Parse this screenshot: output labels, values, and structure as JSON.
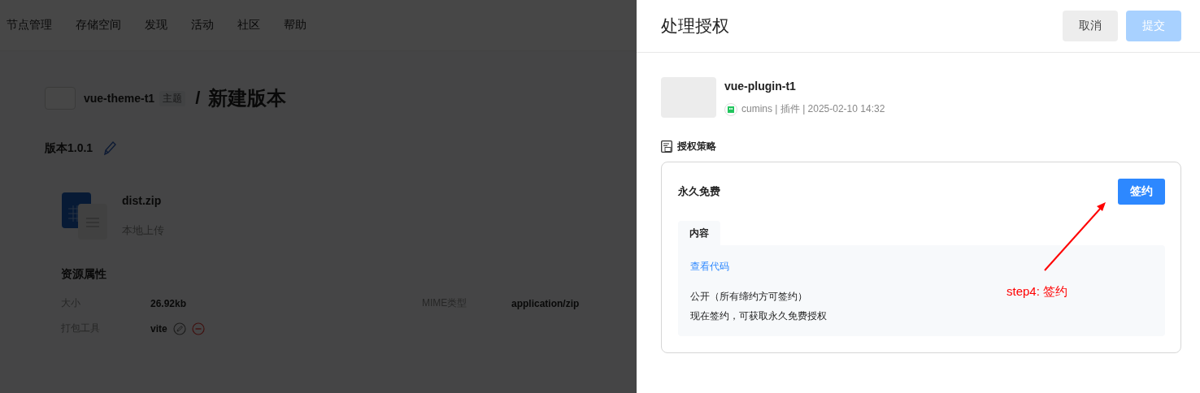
{
  "nav": {
    "items": [
      "节点管理",
      "存储空间",
      "发现",
      "活动",
      "社区",
      "帮助"
    ]
  },
  "page": {
    "resource_name": "vue-theme-t1",
    "resource_tag": "主题",
    "separator": "/",
    "title": "新建版本",
    "version": "版本1.0.1",
    "file": {
      "name": "dist.zip",
      "source": "本地上传"
    },
    "properties_title": "资源属性",
    "properties": [
      {
        "kind": "text",
        "label": "大小",
        "value": "26.92kb"
      },
      {
        "kind": "text",
        "label": "MIME类型",
        "value": "application/zip"
      },
      {
        "kind": "tool",
        "label": "打包工具",
        "value": "vite"
      }
    ]
  },
  "drawer": {
    "title": "处理授权",
    "buttons": [
      {
        "label": "取消",
        "kind": "secondary",
        "disabled": false
      },
      {
        "label": "提交",
        "kind": "primary",
        "disabled": true
      }
    ],
    "resource": {
      "name": "vue-plugin-t1",
      "meta": "cumins | 插件 | 2025-02-10 14:32"
    },
    "policy_heading": "授权策略",
    "policy": {
      "name": "永久免费",
      "action": "签约",
      "tabs": [
        {
          "label": "内容",
          "selected": true
        }
      ],
      "link": "查看代码",
      "lines": [
        "公开（所有缔约方可签约）",
        "现在签约，可获取永久免费授权"
      ]
    }
  },
  "annotation": {
    "text": "step4: 签约"
  }
}
